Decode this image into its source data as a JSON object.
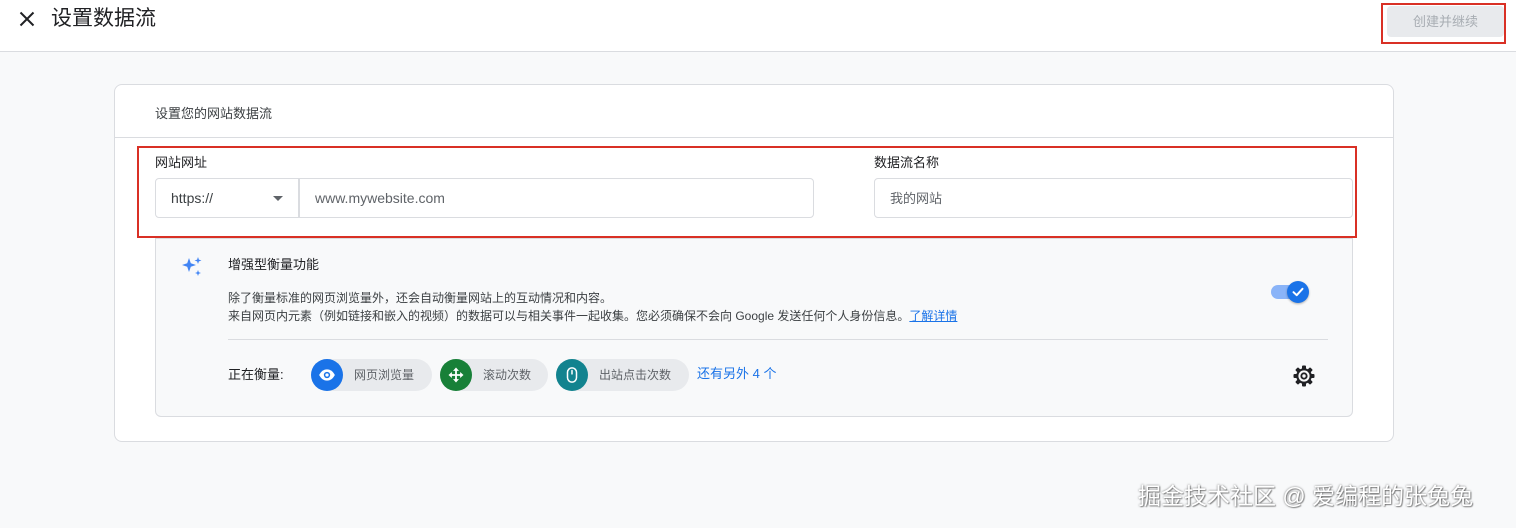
{
  "header": {
    "title": "设置数据流",
    "create_button": "创建并继续"
  },
  "card": {
    "heading": "设置您的网站数据流",
    "url_field": {
      "label": "网站网址",
      "protocol": "https://",
      "placeholder": "www.mywebsite.com"
    },
    "name_field": {
      "label": "数据流名称",
      "placeholder": "我的网站"
    }
  },
  "enhanced_measurement": {
    "title": "增强型衡量功能",
    "description_line1": "除了衡量标准的网页浏览量外，还会自动衡量网站上的互动情况和内容。",
    "description_line2": "来自网页内元素（例如链接和嵌入的视频）的数据可以与相关事件一起收集。您必须确保不会向 Google 发送任何个人身份信息。",
    "learn_more": "了解详情",
    "toggle_on": true,
    "measuring_label": "正在衡量:",
    "chips": [
      {
        "label": "网页浏览量",
        "icon": "eye-icon",
        "color": "#1a73e8"
      },
      {
        "label": "滚动次数",
        "icon": "scroll-arrows-icon",
        "color": "#188038"
      },
      {
        "label": "出站点击次数",
        "icon": "mouse-icon",
        "color": "#12838f"
      }
    ],
    "more_link": "还有另外 4 个"
  },
  "watermark": "掘金技术社区 @ 爱编程的张兔兔",
  "colors": {
    "accent": "#1a73e8",
    "highlight_border": "#d93025"
  }
}
